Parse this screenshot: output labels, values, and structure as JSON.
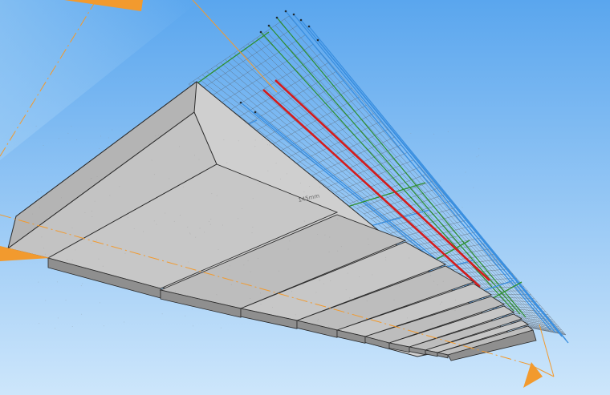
{
  "viewport": {
    "background_top": "#5aa6ee",
    "background_bottom": "#cde6fb"
  },
  "colors": {
    "concrete_light": "#cfcfcf",
    "concrete_mid": "#b4b4b4",
    "concrete_dark": "#8f8f8f",
    "edge": "#2a2a2a",
    "mesh": "#5c6670",
    "rebar_red": "#d41c1c",
    "rebar_blue": "#3a8fe0",
    "rebar_green": "#2e8f2e",
    "axis_orange": "#f29a2e"
  },
  "annotations": {
    "dimension_text": "145mm"
  },
  "icons": {
    "axis_arrows": "orange-triangle-arrow-icon"
  }
}
